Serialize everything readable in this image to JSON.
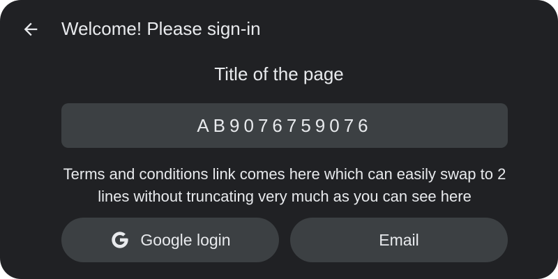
{
  "header": {
    "back_icon": "arrow-back-icon",
    "title": "Welcome! Please sign-in"
  },
  "page_title": "Title of the page",
  "code_field": {
    "value": "AB9076759076"
  },
  "terms": {
    "text": "Terms and conditions link comes here which can easily swap to 2 lines without truncating very much as you can see here"
  },
  "buttons": {
    "google_icon": "google-icon",
    "google_label": "Google login",
    "email_label": "Email"
  },
  "colors": {
    "background": "#202124",
    "surface": "#3c4043",
    "text": "#e8eaed"
  }
}
